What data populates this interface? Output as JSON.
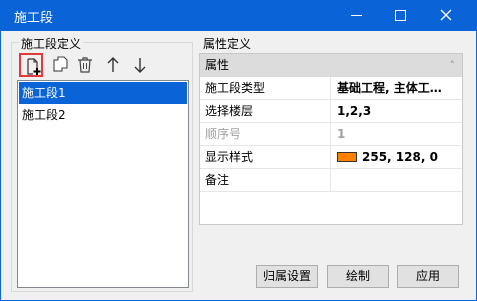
{
  "window": {
    "title": "施工段"
  },
  "left_panel": {
    "group_title": "施工段定义",
    "toolbar": [
      {
        "name": "add-segment-icon",
        "selected": true
      },
      {
        "name": "copy-icon",
        "selected": false
      },
      {
        "name": "delete-icon",
        "selected": false
      },
      {
        "name": "arrow-up-icon",
        "selected": false
      },
      {
        "name": "arrow-down-icon",
        "selected": false
      }
    ],
    "items": [
      {
        "label": "施工段1",
        "selected": true
      },
      {
        "label": "施工段2",
        "selected": false
      }
    ]
  },
  "right_panel": {
    "group_title": "属性定义",
    "grid_header": "属性",
    "rows": [
      {
        "name": "施工段类型",
        "value": "基础工程, 主体工…"
      },
      {
        "name": "选择楼层",
        "value": "1,2,3"
      },
      {
        "name": "顺序号",
        "value": "1"
      },
      {
        "name": "显示样式",
        "value": "255, 128, 0",
        "swatch_color": "#ff8000"
      },
      {
        "name": "备注",
        "value": ""
      }
    ]
  },
  "buttons": {
    "assign": "归属设置",
    "draw": "绘制",
    "apply": "应用"
  },
  "colors": {
    "accent": "#0a64d8",
    "highlight": "#e23a3a",
    "swatch": "#ff8000"
  }
}
